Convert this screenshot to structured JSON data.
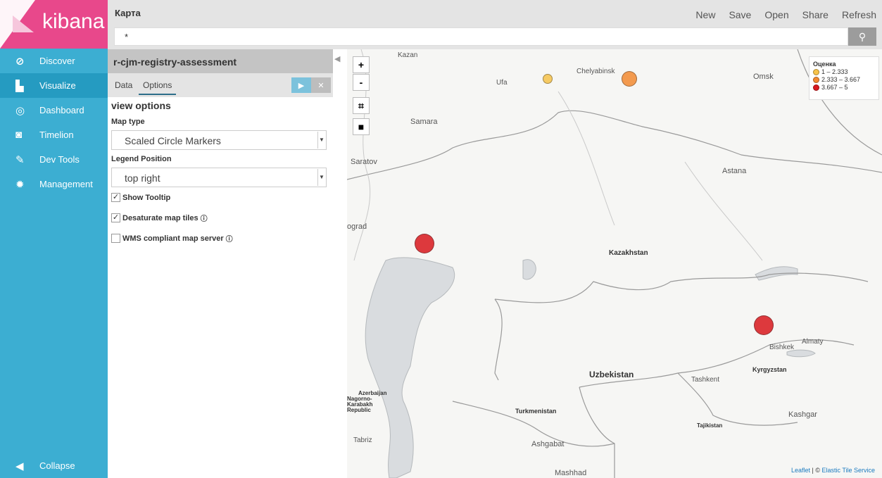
{
  "sidebar": {
    "logo": "kibana",
    "items": [
      {
        "label": "Discover",
        "icon": "compass-icon"
      },
      {
        "label": "Visualize",
        "icon": "bar-chart-icon"
      },
      {
        "label": "Dashboard",
        "icon": "gauge-icon"
      },
      {
        "label": "Timelion",
        "icon": "mask-icon"
      },
      {
        "label": "Dev Tools",
        "icon": "wrench-icon"
      },
      {
        "label": "Management",
        "icon": "gear-icon"
      }
    ],
    "collapse": "Collapse"
  },
  "topbar": {
    "title": "Карта",
    "menu": [
      "New",
      "Save",
      "Open",
      "Share",
      "Refresh"
    ]
  },
  "search": {
    "value": "*"
  },
  "editor": {
    "index_name": "r-cjm-registry-assessment",
    "tabs": [
      "Data",
      "Options"
    ],
    "section_title": "view options",
    "map_type_label": "Map type",
    "map_type_value": "Scaled Circle Markers",
    "legend_position_label": "Legend Position",
    "legend_position_value": "top right",
    "checks": [
      {
        "label": "Show Tooltip",
        "checked": true
      },
      {
        "label": "Desaturate map tiles",
        "checked": true
      },
      {
        "label": "WMS compliant map server",
        "checked": false
      }
    ]
  },
  "map": {
    "zoom_in": "+",
    "zoom_out": "-",
    "places": [
      "Kazan",
      "Chelyabinsk",
      "Omsk",
      "Ufa",
      "Samara",
      "Saratov",
      "Astana",
      "ograd",
      "Kazakhstan",
      "Almaty",
      "Bishkek",
      "Kyrgyzstan",
      "Uzbekistan",
      "Tashkent",
      "Azerbaijan",
      "Nagorno-Karabakh Republic",
      "Turkmenistan",
      "Kashgar",
      "Tajikistan",
      "Tabriz",
      "Ashgabat",
      "Mashhad"
    ],
    "legend": {
      "title": "Оценка",
      "entries": [
        {
          "label": "1 – 2.333",
          "color": "#f7c34a"
        },
        {
          "label": "2.333 – 3.667",
          "color": "#f38a32"
        },
        {
          "label": "3.667 – 5",
          "color": "#d9191e"
        }
      ]
    },
    "markers": [
      {
        "lat": 55.0,
        "lng": 61.0,
        "class": "1 – 2.333",
        "color": "#f7c34a"
      },
      {
        "lat": 55.0,
        "lng": 67.0,
        "class": "2.333 – 3.667",
        "color": "#f38a32"
      },
      {
        "lat": 47.1,
        "lng": 51.9,
        "class": "3.667 – 5",
        "color": "#d9191e"
      },
      {
        "lat": 43.2,
        "lng": 76.9,
        "class": "3.667 – 5",
        "color": "#d9191e"
      }
    ],
    "attribution": {
      "leaflet": "Leaflet",
      "sep": " | © ",
      "tiles": "Elastic Tile Service"
    }
  }
}
